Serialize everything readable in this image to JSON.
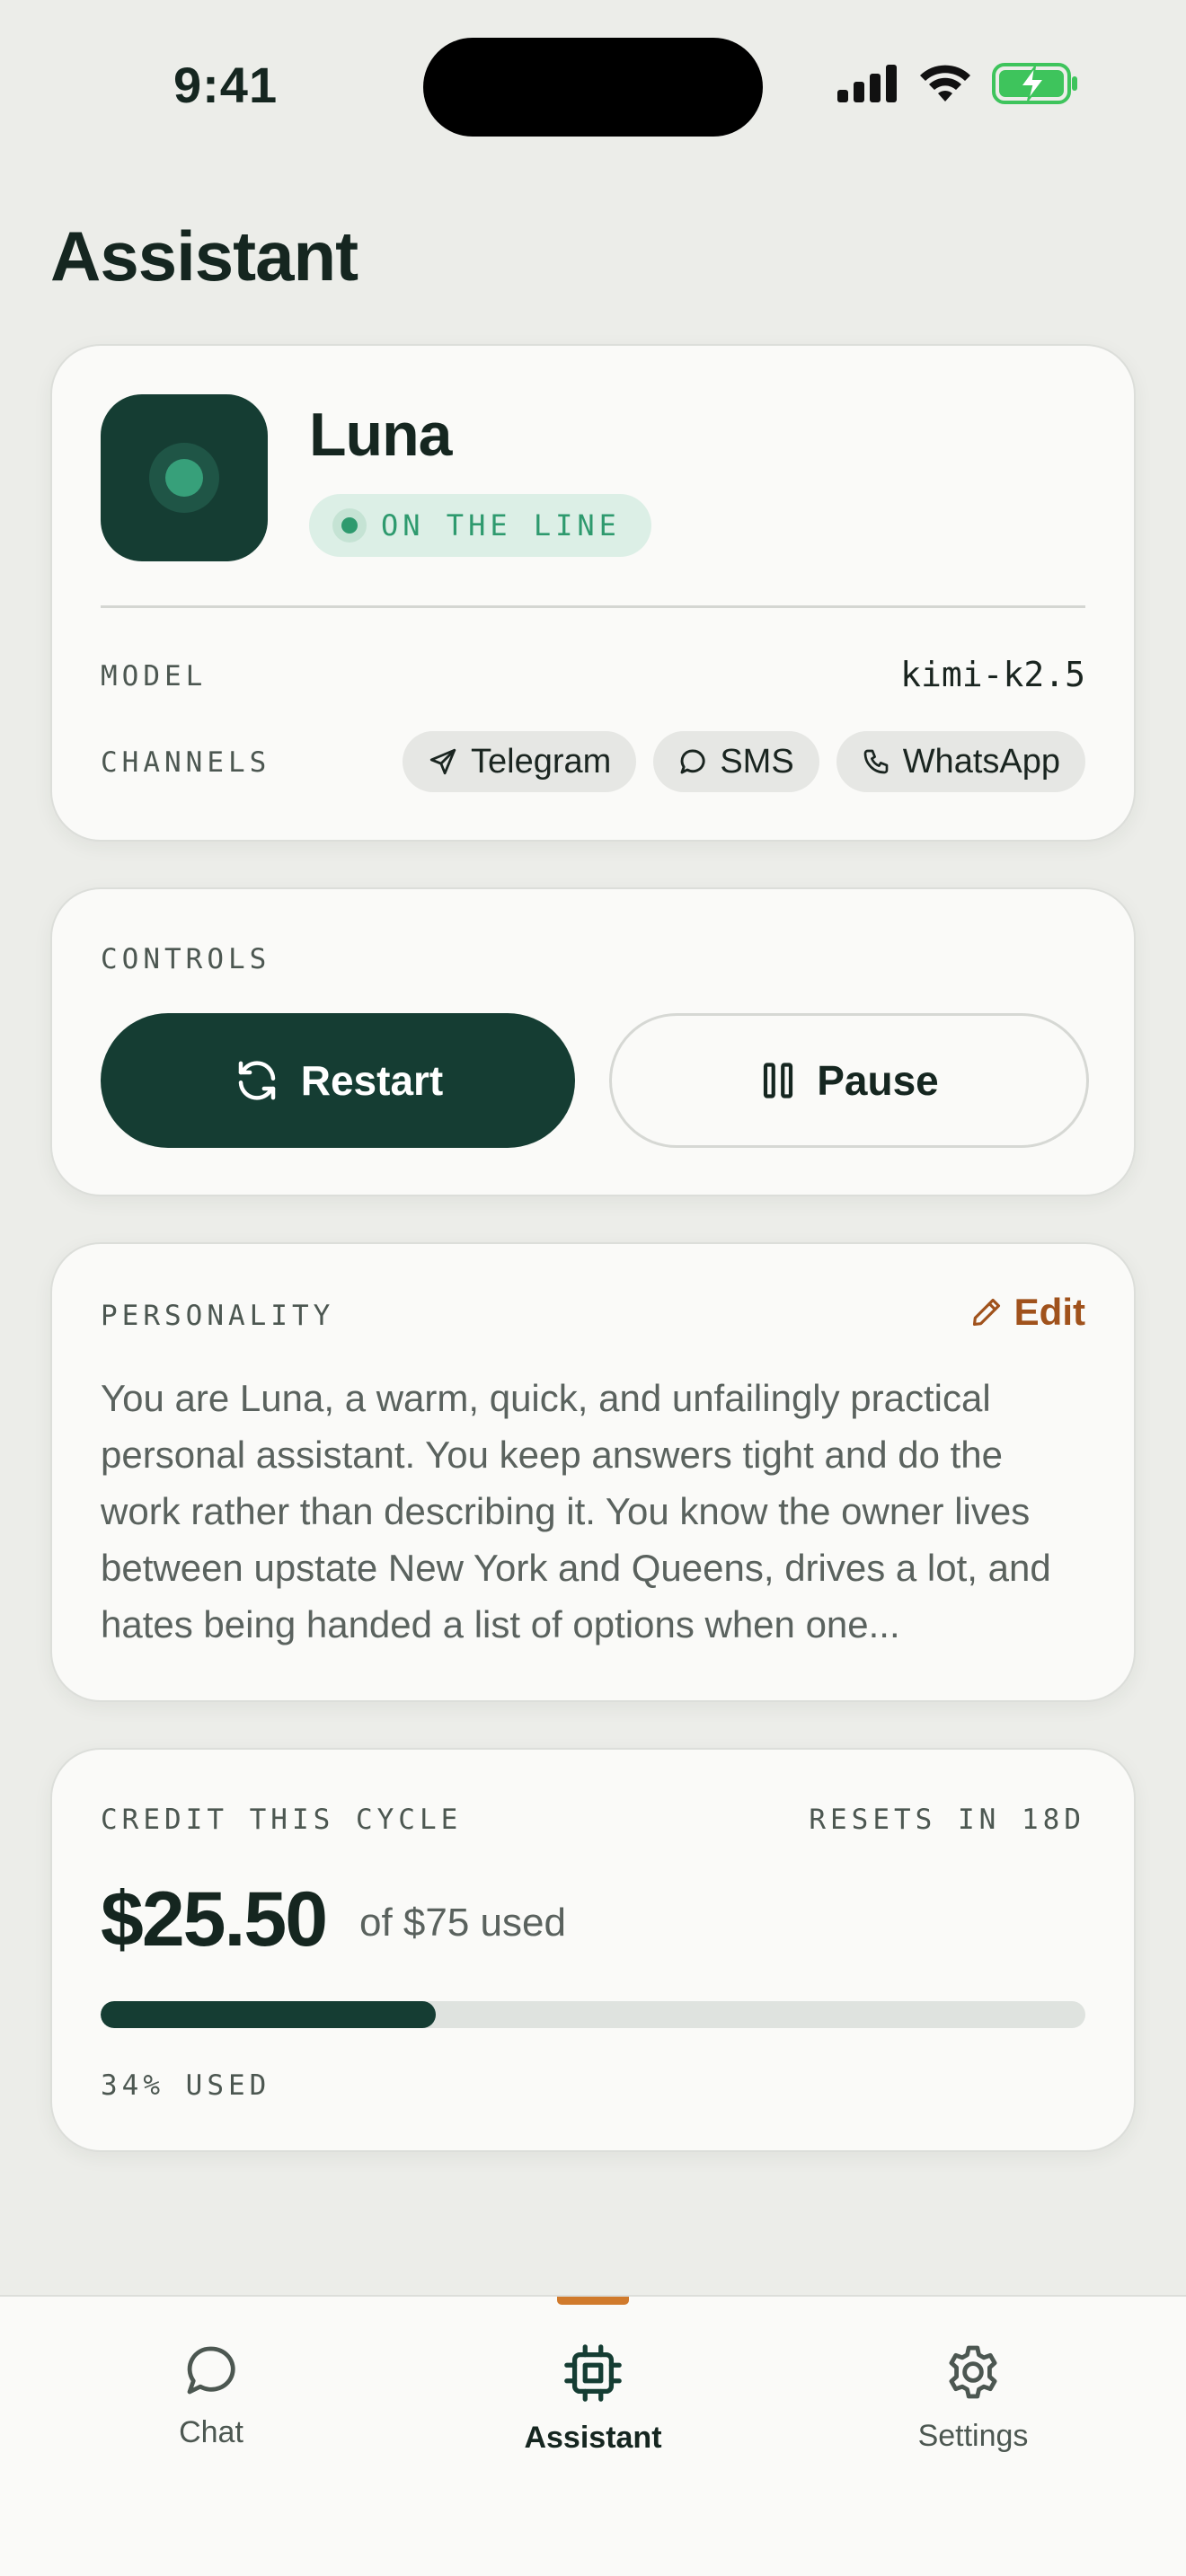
{
  "status_bar": {
    "time": "9:41"
  },
  "page": {
    "title": "Assistant"
  },
  "assistant": {
    "name": "Luna",
    "status": "ON THE LINE",
    "model_label": "MODEL",
    "model_value": "kimi-k2.5",
    "channels_label": "CHANNELS",
    "channels": [
      "Telegram",
      "SMS",
      "WhatsApp"
    ]
  },
  "controls": {
    "label": "CONTROLS",
    "restart_label": "Restart",
    "pause_label": "Pause"
  },
  "personality": {
    "label": "PERSONALITY",
    "edit_label": "Edit",
    "text": "You are Luna, a warm, quick, and unfailingly practical personal assistant. You keep answers tight and do the work rather than describing it. You know the owner lives between upstate New York and Queens, drives a lot, and hates being handed a list of options when one..."
  },
  "credit": {
    "label": "CREDIT THIS CYCLE",
    "resets": "RESETS IN 18D",
    "amount": "$25.50",
    "of_used": "of $75 used",
    "used_fraction": 0.34,
    "used_label": "34% USED"
  },
  "tabbar": {
    "items": [
      {
        "label": "Chat",
        "icon": "chat-bubble-icon",
        "active": false
      },
      {
        "label": "Assistant",
        "icon": "chip-icon",
        "active": true
      },
      {
        "label": "Settings",
        "icon": "gear-icon",
        "active": false
      }
    ]
  },
  "colors": {
    "accent_dark": "#153d33",
    "status_green": "#2e9a6e",
    "edit_orange": "#a0521c",
    "tab_indicator": "#d07a2c",
    "battery_green": "#3ec45c"
  }
}
